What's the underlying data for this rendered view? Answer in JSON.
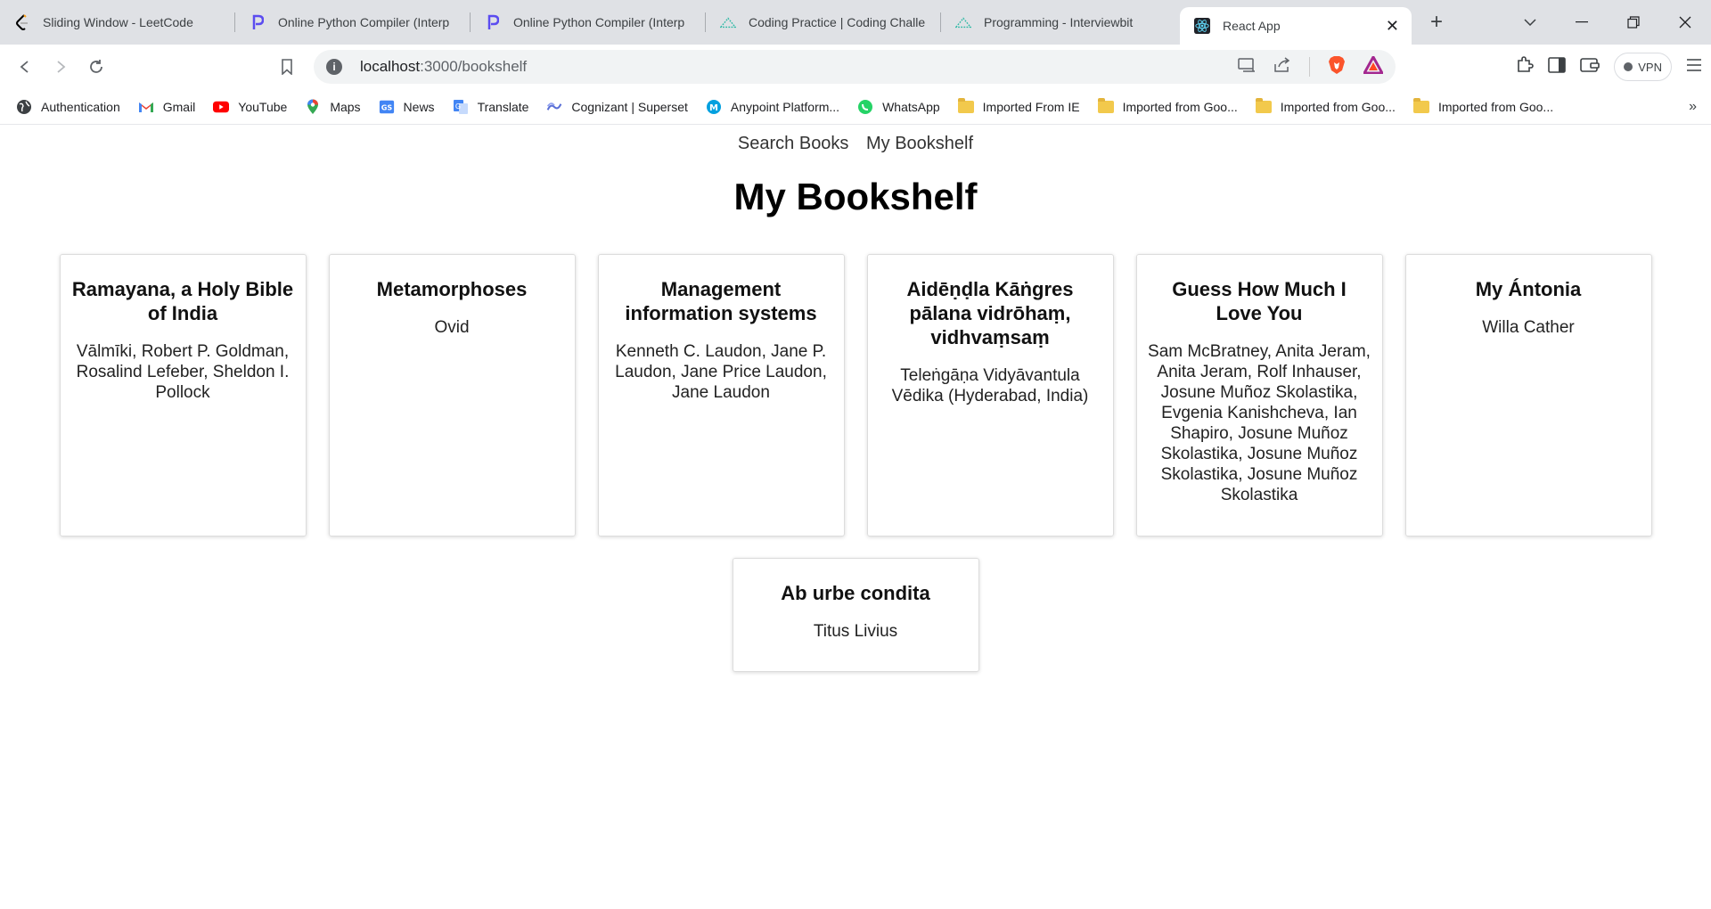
{
  "browser": {
    "tabs": [
      {
        "title": "Sliding Window - LeetCode",
        "icon": "leetcode-icon"
      },
      {
        "title": "Online Python Compiler (Interp",
        "icon": "programiz-icon"
      },
      {
        "title": "Online Python Compiler (Interp",
        "icon": "programiz-icon"
      },
      {
        "title": "Coding Practice | Coding Challe",
        "icon": "interviewbit-icon"
      },
      {
        "title": "Programming - Interviewbit",
        "icon": "interviewbit-icon"
      }
    ],
    "active_tab": {
      "title": "React App",
      "icon": "react-icon"
    },
    "url_host": "localhost",
    "url_path": ":3000/bookshelf",
    "vpn_label": "VPN",
    "bookmarks": [
      {
        "label": "Authentication",
        "icon": "globe-icon"
      },
      {
        "label": "Gmail",
        "icon": "gmail-icon"
      },
      {
        "label": "YouTube",
        "icon": "youtube-icon"
      },
      {
        "label": "Maps",
        "icon": "maps-icon"
      },
      {
        "label": "News",
        "icon": "news-icon"
      },
      {
        "label": "Translate",
        "icon": "translate-icon"
      },
      {
        "label": "Cognizant | Superset",
        "icon": "superset-icon"
      },
      {
        "label": "Anypoint Platform...",
        "icon": "mulesoft-icon"
      },
      {
        "label": "WhatsApp",
        "icon": "whatsapp-icon"
      },
      {
        "label": "Imported From IE",
        "icon": "folder-icon"
      },
      {
        "label": "Imported from Goo...",
        "icon": "folder-icon"
      },
      {
        "label": "Imported from Goo...",
        "icon": "folder-icon"
      },
      {
        "label": "Imported from Goo...",
        "icon": "folder-icon"
      }
    ],
    "more_bookmarks": "»"
  },
  "app": {
    "nav": {
      "search": "Search Books",
      "bookshelf": "My Bookshelf"
    },
    "title": "My Bookshelf",
    "books": [
      {
        "title": "Ramayana, a Holy Bible of India",
        "authors": "Vālmīki, Robert P. Goldman, Rosalind Lefeber, Sheldon I. Pollock"
      },
      {
        "title": "Metamorphoses",
        "authors": "Ovid"
      },
      {
        "title": "Management information systems",
        "authors": "Kenneth C. Laudon, Jane P. Laudon, Jane Price Laudon, Jane Laudon"
      },
      {
        "title": "Aidēṇḍla Kāṅgres pālana vidrōhaṃ, vidhvaṃsaṃ",
        "authors": "Teleṅgāṇa Vidyāvantula Vēdika (Hyderabad, India)"
      },
      {
        "title": "Guess How Much I Love You",
        "authors": "Sam McBratney, Anita Jeram, Anita Jeram, Rolf Inhauser, Josune Muñoz Skolastika, Evgenia Kanishcheva, Ian Shapiro, Josune Muñoz Skolastika, Josune Muñoz Skolastika, Josune Muñoz Skolastika"
      },
      {
        "title": "My Ántonia",
        "authors": "Willa Cather"
      },
      {
        "title": "Ab urbe condita",
        "authors": "Titus Livius"
      }
    ]
  }
}
